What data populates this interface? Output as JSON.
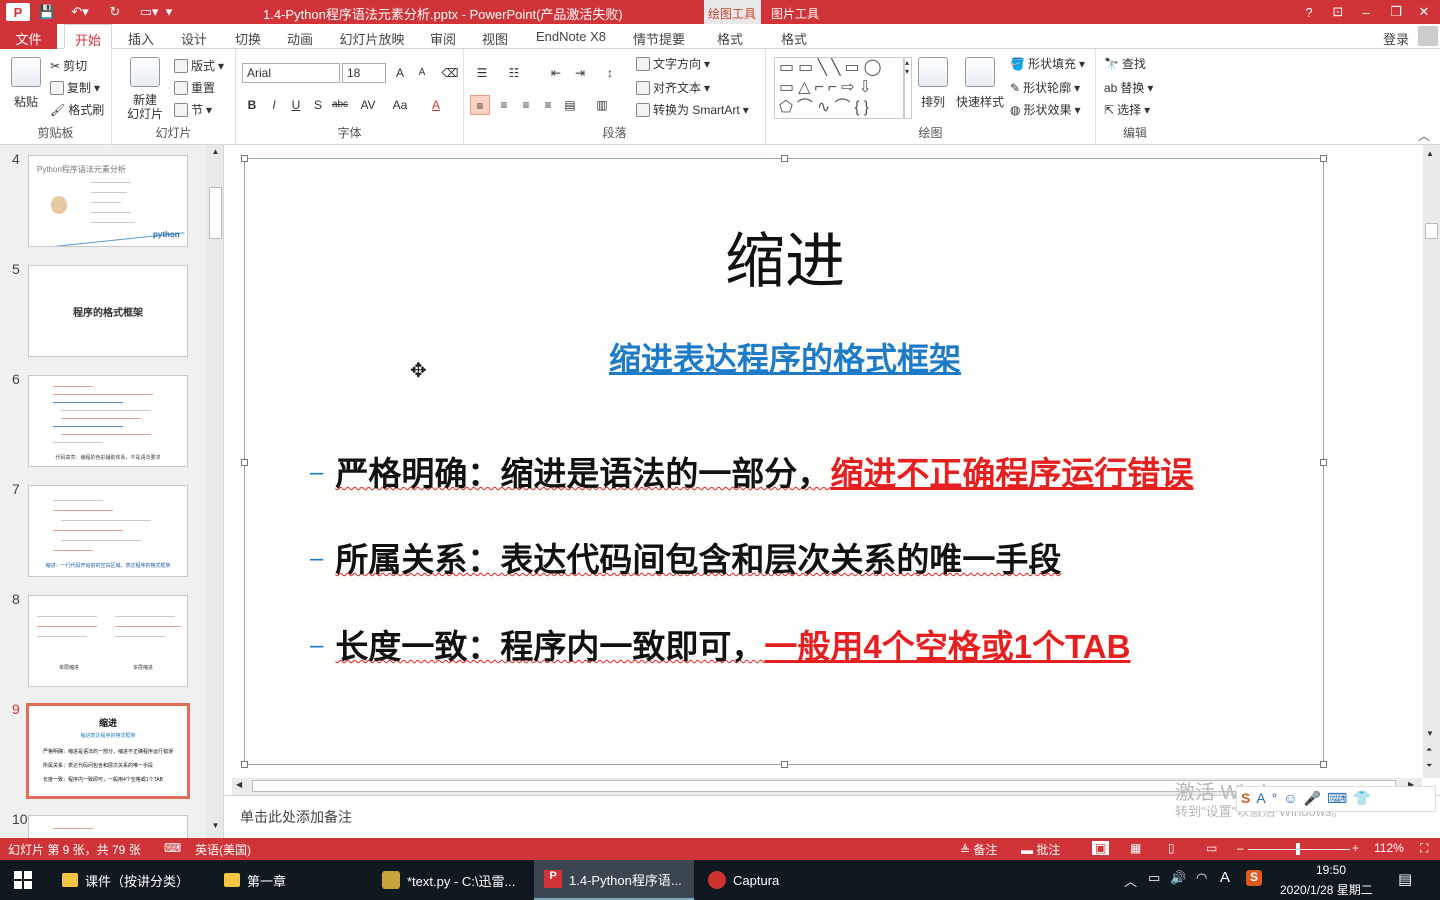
{
  "titlebar": {
    "title": "1.4-Python程序语法元素分析.pptx -  PowerPoint(产品激活失败)",
    "context_tool_1": "绘图工具",
    "context_tool_2": "图片工具",
    "help": "?",
    "minimize": "–",
    "restore": "❐",
    "close": "✕"
  },
  "tabs": [
    "文件",
    "开始",
    "插入",
    "设计",
    "切换",
    "动画",
    "幻灯片放映",
    "审阅",
    "视图",
    "EndNote X8",
    "情节提要",
    "格式",
    "格式"
  ],
  "signin": "登录",
  "ribbon": {
    "clipboard": {
      "label": "剪贴板",
      "paste": "粘贴",
      "cut": "剪切",
      "copy": "复制",
      "painter": "格式刷"
    },
    "slides": {
      "label": "幻灯片",
      "new_slide": "新建\n幻灯片",
      "layout": "版式",
      "reset": "重置",
      "section": "节"
    },
    "font": {
      "label": "字体",
      "font_name": "Arial",
      "font_size": "18",
      "bold": "B",
      "italic": "I",
      "underline": "U",
      "shadow": "S",
      "strike": "abc",
      "spacing": "AV",
      "case": "Aa",
      "color": "A",
      "grow": "A",
      "shrink": "A"
    },
    "paragraph": {
      "label": "段落",
      "text_direction": "文字方向",
      "align_text": "对齐文本",
      "smartart": "转换为 SmartArt"
    },
    "drawing": {
      "label": "绘图",
      "arrange": "排列",
      "quick_styles": "快速样式",
      "fill": "形状填充",
      "outline": "形状轮廓",
      "effects": "形状效果"
    },
    "editing": {
      "label": "编辑",
      "find": "查找",
      "replace": "替换",
      "select": "选择"
    }
  },
  "thumbnails": [
    {
      "num": "4",
      "title": "Python程序语法元素分析",
      "footer": "python"
    },
    {
      "num": "5",
      "title": "程序的格式框架"
    },
    {
      "num": "6",
      "caption": "代码高亮：编程的色彩辅助体系，不是语法要求"
    },
    {
      "num": "7",
      "caption": "缩进：一行代码开始前的空白区域，表达程序的格式框架"
    },
    {
      "num": "8",
      "caption_left": "单层缩进",
      "caption_right": "多层缩进"
    },
    {
      "num": "9",
      "title": "缩进",
      "subtitle": "缩进表达程序的格式框架",
      "lines": [
        "严格明确：缩进是语法的一部分，缩进不正确程序运行错误",
        "所属关系：表达代码间包含和层次关系的唯一手段",
        "长度一致：程序内一致即可，一般用4个空格或1个TAB"
      ]
    },
    {
      "num": "10"
    }
  ],
  "slide": {
    "title": "缩进",
    "subtitle": "缩进表达程序的格式框架",
    "bullets": [
      {
        "text": "严格明确：缩进是语法的一部分，",
        "red": "缩进不正确程序运行错误"
      },
      {
        "text": "所属关系：表达代码间包含和层次关系的唯一手段",
        "red": ""
      },
      {
        "text": "长度一致：程序内一致即可，",
        "red": "一般用4个空格或1个TAB"
      }
    ]
  },
  "notes_placeholder": "单击此处添加备注",
  "watermark": {
    "line1": "激活 Windows",
    "line2": "转到\"设置\"以激活 Windows。"
  },
  "statusbar": {
    "slide_info": "幻灯片 第 9 张，共 79 张",
    "language": "英语(美国)",
    "notes": "备注",
    "comments": "批注",
    "zoom": "112%"
  },
  "taskbar": {
    "items": [
      "课件（按讲分类）",
      "第一章",
      "*text.py - C:\\迅雷...",
      "1.4-Python程序语...",
      "Captura"
    ],
    "time": "19:50",
    "date": "2020/1/28 星期二",
    "ime": "A"
  },
  "colors": {
    "accent": "#d13438",
    "subtitle": "#1e7bc8",
    "highlight": "#e62020"
  }
}
